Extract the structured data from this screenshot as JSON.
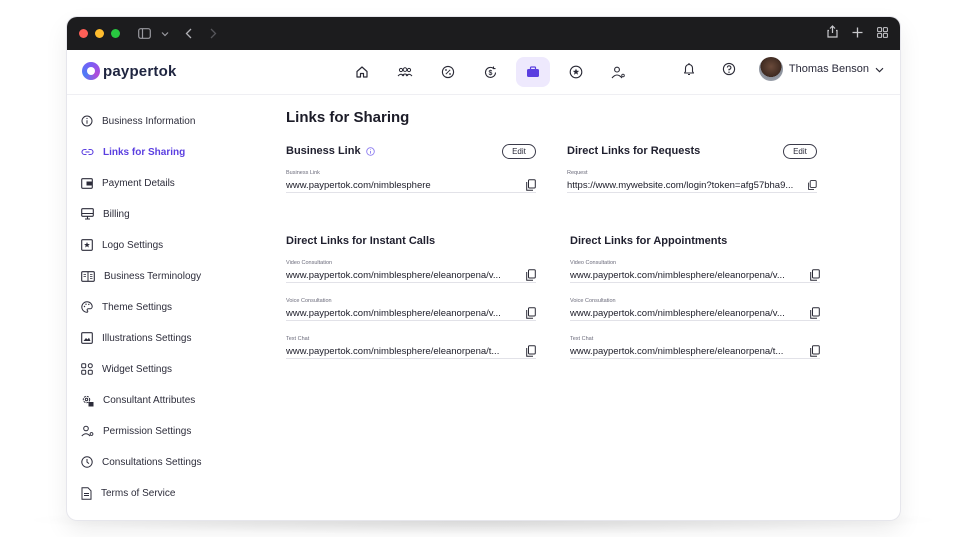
{
  "colors": {
    "accent": "#5b3fe0",
    "active_nav_bg": "#eee9fd",
    "chrome_bg": "#1c1c1e",
    "text": "#1f1f2e"
  },
  "browser": {
    "traffic_lights": [
      "close",
      "minimize",
      "zoom"
    ],
    "icons": [
      "sidebar-toggle-icon",
      "chevron-down-icon",
      "back-arrow-icon",
      "forward-arrow-icon",
      "share-icon",
      "new-tab-icon",
      "tab-grid-icon"
    ]
  },
  "header": {
    "logo_text": "paypertok",
    "nav_icons": [
      "home-icon",
      "team-icon",
      "percent-icon",
      "dollar-refresh-icon",
      "briefcase-icon",
      "star-badge-icon",
      "user-settings-icon"
    ],
    "active_nav": "briefcase-icon",
    "user_name": "Thomas Benson"
  },
  "sidebar": {
    "items": [
      {
        "label": "Business Information",
        "icon": "info-icon"
      },
      {
        "label": "Links for Sharing",
        "icon": "link-icon",
        "active": true
      },
      {
        "label": "Payment Details",
        "icon": "wallet-icon"
      },
      {
        "label": "Billing",
        "icon": "monitor-icon"
      },
      {
        "label": "Logo Settings",
        "icon": "star-square-icon"
      },
      {
        "label": "Business Terminology",
        "icon": "book-icon"
      },
      {
        "label": "Theme Settings",
        "icon": "palette-icon"
      },
      {
        "label": "Illustrations Settings",
        "icon": "image-icon"
      },
      {
        "label": "Widget Settings",
        "icon": "widgets-icon"
      },
      {
        "label": "Consultant Attributes",
        "icon": "attributes-icon"
      },
      {
        "label": "Permission Settings",
        "icon": "user-key-icon"
      },
      {
        "label": "Consultations Settings",
        "icon": "clock-icon"
      },
      {
        "label": "Terms of Service",
        "icon": "document-icon"
      }
    ]
  },
  "main": {
    "title": "Links for Sharing",
    "business_link": {
      "title": "Business Link",
      "edit_label": "Edit",
      "field_label": "Business Link",
      "value": "www.paypertok.com/nimblesphere"
    },
    "direct_requests": {
      "title": "Direct Links for Requests",
      "edit_label": "Edit",
      "field_label": "Request",
      "value": "https://www.mywebsite.com/login?token=afg57bha9..."
    },
    "instant_calls": {
      "title": "Direct Links for Instant Calls",
      "fields": [
        {
          "label": "Video Consultation",
          "value": "www.paypertok.com/nimblesphere/eleanorpena/v..."
        },
        {
          "label": "Voice Consultation",
          "value": "www.paypertok.com/nimblesphere/eleanorpena/v..."
        },
        {
          "label": "Text Chat",
          "value": "www.paypertok.com/nimblesphere/eleanorpena/t..."
        }
      ]
    },
    "appointments": {
      "title": "Direct Links for Appointments",
      "fields": [
        {
          "label": "Video Consultation",
          "value": "www.paypertok.com/nimblesphere/eleanorpena/v..."
        },
        {
          "label": "Voice Consultation",
          "value": "www.paypertok.com/nimblesphere/eleanorpena/v..."
        },
        {
          "label": "Text Chat",
          "value": "www.paypertok.com/nimblesphere/eleanorpena/t..."
        }
      ]
    }
  }
}
